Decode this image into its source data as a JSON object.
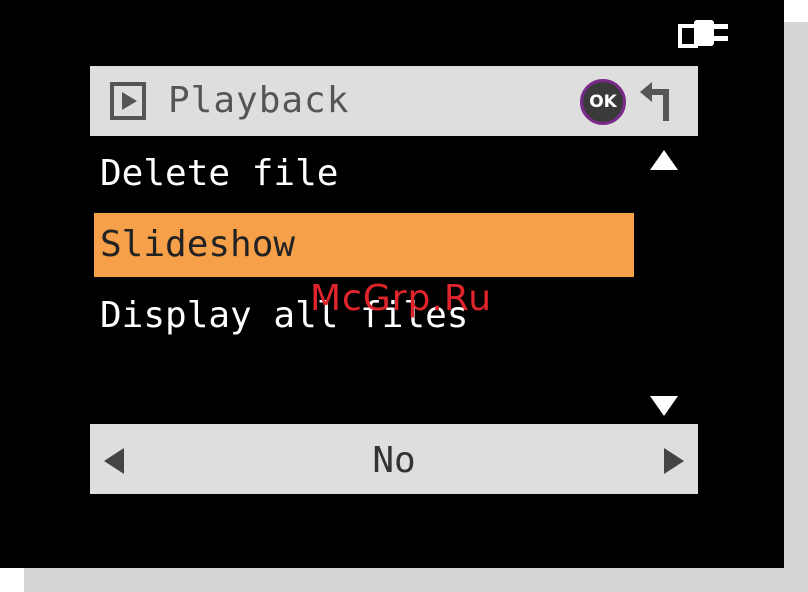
{
  "header": {
    "title": "Playback",
    "ok_label": "OK",
    "play_icon": "play-icon",
    "back_icon": "return-arrow-icon"
  },
  "status": {
    "power_icon": "power-plug-icon"
  },
  "menu": {
    "items": [
      {
        "label": "Delete file",
        "selected": false
      },
      {
        "label": "Slideshow",
        "selected": true
      },
      {
        "label": "Display all files",
        "selected": false
      }
    ],
    "scroll_up_icon": "triangle-up-icon",
    "scroll_down_icon": "triangle-down-icon"
  },
  "value": {
    "current": "No",
    "prev_icon": "triangle-left-icon",
    "next_icon": "triangle-right-icon"
  },
  "watermark": {
    "text": "McGrp.Ru"
  },
  "colors": {
    "screen_bg": "#000000",
    "bar_bg": "#dedede",
    "selected_bg": "#f7a04a",
    "watermark": "#e0242b"
  }
}
